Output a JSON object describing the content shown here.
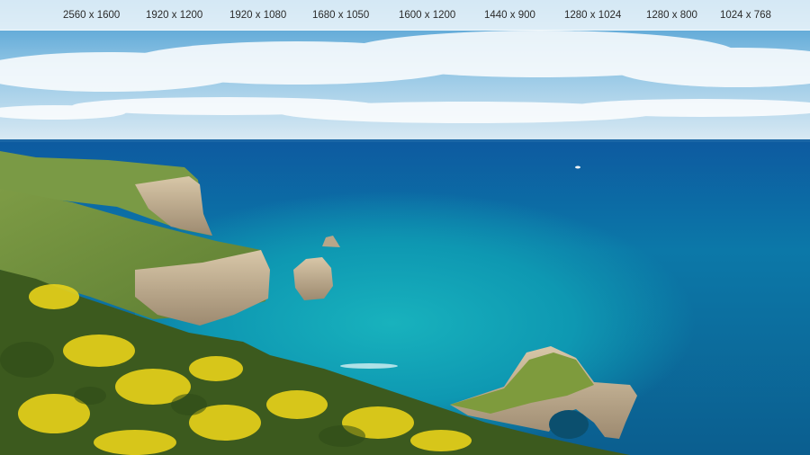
{
  "resolutions": [
    {
      "label": "2560 x 1600"
    },
    {
      "label": "1920 x 1200"
    },
    {
      "label": "1920 x 1080"
    },
    {
      "label": "1680 x 1050"
    },
    {
      "label": "1600 x 1200"
    },
    {
      "label": "1440 x 900"
    },
    {
      "label": "1280 x 1024"
    },
    {
      "label": "1280 x 800"
    },
    {
      "label": "1024 x 768"
    }
  ],
  "colors": {
    "sky_top": "#4e9fd4",
    "sky_horizon": "#dcebf4",
    "sea_far": "#0f5f9e",
    "sea_near": "#0fa0b4",
    "grass": "#6e8f3e",
    "gorse_yellow": "#e8d21a",
    "cliff": "#c9b79a"
  }
}
